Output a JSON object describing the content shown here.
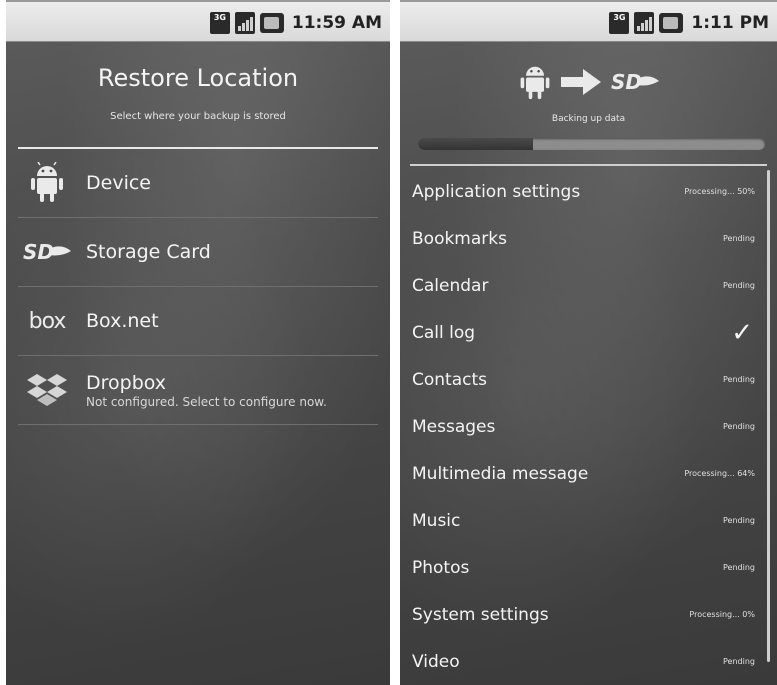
{
  "left": {
    "status": {
      "time": "11:59 AM",
      "network_badge": "3G"
    },
    "title": "Restore Location",
    "subtitle": "Select where your backup is stored",
    "locations": [
      {
        "label": "Device",
        "icon": "android-icon"
      },
      {
        "label": "Storage Card",
        "icon": "sd-card-icon"
      },
      {
        "label": "Box.net",
        "icon": "box-logo-icon",
        "logo_text": "box"
      },
      {
        "label": "Dropbox",
        "sub": "Not configured. Select to configure now.",
        "icon": "dropbox-icon"
      }
    ]
  },
  "right": {
    "status": {
      "time": "1:11 PM",
      "network_badge": "3G"
    },
    "backing_label": "Backing up data",
    "progress": 0.33,
    "items": [
      {
        "label": "Application settings",
        "status": "Processing... 50%"
      },
      {
        "label": "Bookmarks",
        "status": "Pending"
      },
      {
        "label": "Calendar",
        "status": "Pending"
      },
      {
        "label": "Call log",
        "status": "✓"
      },
      {
        "label": "Contacts",
        "status": "Pending"
      },
      {
        "label": "Messages",
        "status": "Pending"
      },
      {
        "label": "Multimedia message",
        "status": "Processing... 64%"
      },
      {
        "label": "Music",
        "status": "Pending"
      },
      {
        "label": "Photos",
        "status": "Pending"
      },
      {
        "label": "System settings",
        "status": "Processing... 0%"
      },
      {
        "label": "Video",
        "status": "Pending"
      }
    ]
  },
  "colors": {
    "background": "#4a4a4a",
    "text": "#f4f4f4",
    "statusbar": "#e3e3e3"
  }
}
